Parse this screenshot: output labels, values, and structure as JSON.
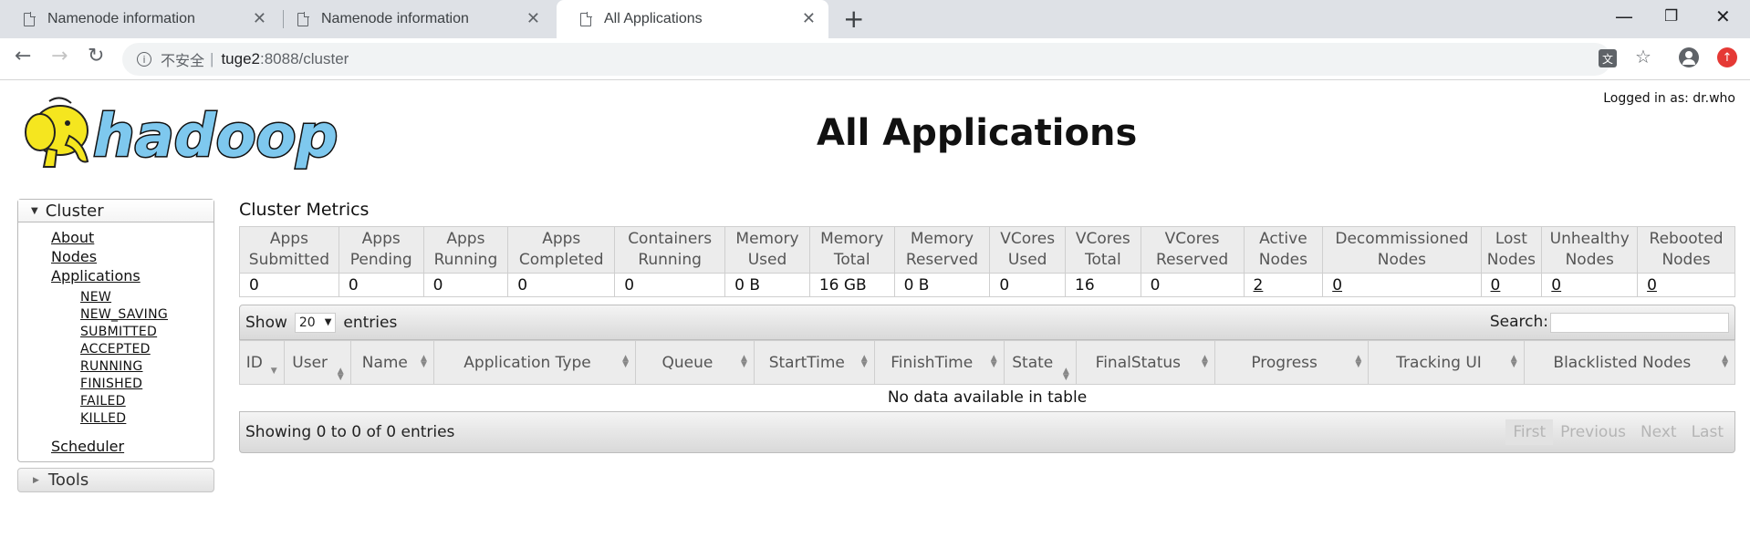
{
  "browser": {
    "tabs": [
      {
        "title": "Namenode information",
        "active": false
      },
      {
        "title": "Namenode information",
        "active": false
      },
      {
        "title": "All Applications",
        "active": true
      }
    ],
    "address": {
      "security_label": "不安全",
      "host": "tuge2",
      "path": ":8088/cluster"
    }
  },
  "header": {
    "logged_in": "Logged in as: dr.who",
    "title": "All Applications",
    "logo_text": "hadoop"
  },
  "sidebar": {
    "cluster_label": "Cluster",
    "links": [
      "About",
      "Nodes",
      "Applications"
    ],
    "app_states": [
      "NEW",
      "NEW_SAVING",
      "SUBMITTED",
      "ACCEPTED",
      "RUNNING",
      "FINISHED",
      "FAILED",
      "KILLED"
    ],
    "scheduler_label": "Scheduler",
    "tools_label": "Tools"
  },
  "metrics": {
    "title": "Cluster Metrics",
    "headers": [
      [
        "Apps",
        "Submitted"
      ],
      [
        "Apps",
        "Pending"
      ],
      [
        "Apps",
        "Running"
      ],
      [
        "Apps",
        "Completed"
      ],
      [
        "Containers",
        "Running"
      ],
      [
        "Memory",
        "Used"
      ],
      [
        "Memory",
        "Total"
      ],
      [
        "Memory",
        "Reserved"
      ],
      [
        "VCores",
        "Used"
      ],
      [
        "VCores",
        "Total"
      ],
      [
        "VCores",
        "Reserved"
      ],
      [
        "Active",
        "Nodes"
      ],
      [
        "Decommissioned",
        "Nodes"
      ],
      [
        "Lost",
        "Nodes"
      ],
      [
        "Unhealthy",
        "Nodes"
      ],
      [
        "Rebooted",
        "Nodes"
      ]
    ],
    "values": [
      "0",
      "0",
      "0",
      "0",
      "0",
      "0 B",
      "16 GB",
      "0 B",
      "0",
      "16",
      "0",
      "2",
      "0",
      "0",
      "0",
      "0"
    ]
  },
  "apps_table": {
    "show_label": "Show",
    "page_size": "20",
    "entries_label": "entries",
    "search_label": "Search:",
    "search_value": "",
    "columns": [
      "ID",
      "User",
      "Name",
      "Application Type",
      "Queue",
      "StartTime",
      "FinishTime",
      "State",
      "FinalStatus",
      "Progress",
      "Tracking UI",
      "Blacklisted Nodes"
    ],
    "empty_message": "No data available in table",
    "info": "Showing 0 to 0 of 0 entries",
    "pager": [
      "First",
      "Previous",
      "Next",
      "Last"
    ]
  },
  "colors": {
    "header_bg": "#ececec",
    "bar_gradient_top": "#f4f4f4",
    "bar_gradient_bottom": "#d9d9d9",
    "logo_yellow": "#f5e61f",
    "logo_blue": "#7ec8ee"
  },
  "icons": [
    "page-icon",
    "close-icon",
    "new-tab-icon",
    "minimize-icon",
    "restore-icon",
    "window-close-icon",
    "back-icon",
    "forward-icon",
    "reload-icon",
    "info-icon",
    "translate-icon",
    "star-icon",
    "profile-icon",
    "update-icon",
    "sort-icon",
    "triangle-down-icon",
    "triangle-right-icon",
    "elephant-icon"
  ]
}
